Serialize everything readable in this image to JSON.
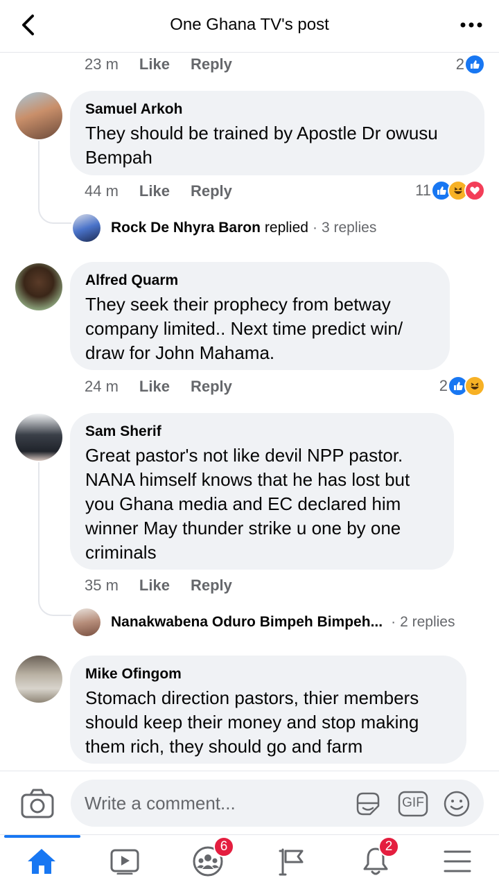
{
  "header": {
    "title": "One Ghana TV's post"
  },
  "comments": [
    {
      "id": "prev",
      "time": "23 m",
      "like": "Like",
      "reply": "Reply",
      "reaction_count": "2"
    },
    {
      "id": "samuel",
      "name": "Samuel Arkoh",
      "text": "They should be trained by Apostle Dr owusu Bempah",
      "time": "44 m",
      "like": "Like",
      "reply": "Reply",
      "reaction_count": "11",
      "replies": {
        "name": "Rock De Nhyra Baron",
        "verb": "replied",
        "sep": "·",
        "count": "3 replies"
      }
    },
    {
      "id": "alfred",
      "name": "Alfred Quarm",
      "text": "They seek their prophecy from betway company limited.. Next time predict win/ draw for John Mahama.",
      "time": "24 m",
      "like": "Like",
      "reply": "Reply",
      "reaction_count": "2"
    },
    {
      "id": "sam",
      "name": "Sam Sherif",
      "text": "Great pastor's not like devil NPP pastor. NANA himself knows that he has lost but you Ghana media and  EC declared him winner May thunder strike u one by one criminals",
      "time": "35 m",
      "like": "Like",
      "reply": "Reply",
      "replies": {
        "name": "Nanakwabena Oduro Bimpeh Bimpeh...",
        "sep": "·",
        "count": "2 replies"
      }
    },
    {
      "id": "mike",
      "name": "Mike Ofingom",
      "text": "Stomach direction pastors, thier members should keep their money and stop making them rich, they should go and farm"
    }
  ],
  "composer": {
    "placeholder": "Write a comment...",
    "gif_label": "GIF"
  },
  "nav": {
    "groups_badge": "6",
    "notifications_badge": "2"
  },
  "colors": {
    "accent": "#1877f2",
    "bubble": "#f0f2f5",
    "secondary_text": "#65676b",
    "badge": "#e41e3f",
    "haha": "#f7b125",
    "love": "#f33e58"
  }
}
